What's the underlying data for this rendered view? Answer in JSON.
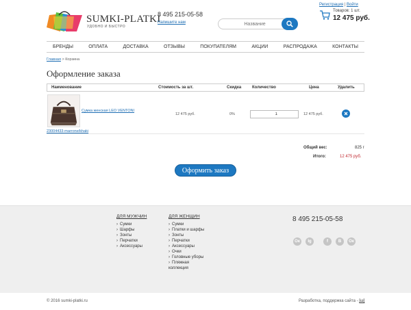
{
  "header": {
    "logo_name": "SUMKI-PLATKI",
    "logo_tagline": "УДОБНО И БЫСТРО",
    "phone": "8 495 215-05-58",
    "write_us": "Напишите нам",
    "search_placeholder": "Название",
    "auth": {
      "register": "Регистрация",
      "separator": " | ",
      "login": "Войти"
    },
    "cart": {
      "count_label": "Товаров: 1 шт.",
      "total": "12 475 руб."
    }
  },
  "nav": [
    "БРЕНДЫ",
    "ОПЛАТА",
    "ДОСТАВКА",
    "ОТЗЫВЫ",
    "ПОКУПАТЕЛЯМ",
    "АКЦИИ",
    "РАСПРОДАЖА",
    "КОНТАКТЫ"
  ],
  "breadcrumb": {
    "home": "Главная",
    "separator": " > ",
    "current": "Корзина"
  },
  "page_title": "Оформление заказа",
  "table": {
    "headers": [
      "Наименование",
      "Стоимость за шт.",
      "Скидка",
      "Количество",
      "Цена",
      "Удалить"
    ],
    "rows": [
      {
        "name": "Сумка женская LEO VENTONI",
        "sku": "23004433-marrone/khaki",
        "unit_price": "12 475 руб.",
        "discount": "0%",
        "quantity": "1",
        "price": "12 475 руб."
      }
    ]
  },
  "summary": {
    "weight_label": "Общий вес:",
    "weight_value": "825 г",
    "total_label": "Итого:",
    "total_value": "12 475 руб."
  },
  "checkout_label": "Оформить заказ",
  "footer": {
    "men": {
      "title": "ДЛЯ МУЖЧИН",
      "items": [
        "Сумки",
        "Шарфы",
        "Зонты",
        "Перчатки",
        "Аксессуары"
      ]
    },
    "women": {
      "title": "ДЛЯ ЖЕНЩИН",
      "items": [
        "Сумки",
        "Платки и шарфы",
        "Зонты",
        "Перчатки",
        "Аксессуары",
        "Очки",
        "Головные уборы",
        "Пляжная коллекция"
      ]
    },
    "phone": "8 495 215-05-58",
    "social": [
      "Ок",
      "Ig",
      "f",
      "В",
      "Ок"
    ],
    "copyright": "© 2016 sumki-platki.ru",
    "dev_label": "Разработка, поддержка сайта - ",
    "dev_link": "[ш]"
  },
  "colors": {
    "accent": "#1d78c1",
    "price_red": "#c0282f",
    "footer_bg": "#efefef"
  }
}
